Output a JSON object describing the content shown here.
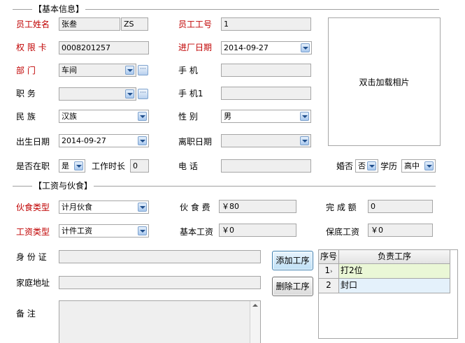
{
  "sections": {
    "basic": "【基本信息】",
    "wage": "【工资与伙食】"
  },
  "basic": {
    "name_label": "员工姓名",
    "name_value": "张叁",
    "name_code": "ZS",
    "empno_label": "员工工号",
    "empno_value": "1",
    "card_label": "权 限 卡",
    "card_value": "0008201257",
    "joindate_label": "进厂日期",
    "joindate_value": "2014-09-27",
    "dept_label": "部    门",
    "dept_value": "车间",
    "mobile_label": "手    机",
    "mobile_value": "",
    "position_label": "职    务",
    "position_value": "",
    "mobile1_label": "手    机1",
    "mobile1_value": "",
    "ethnic_label": "民    族",
    "ethnic_value": "汉族",
    "gender_label": "性    别",
    "gender_value": "男",
    "birth_label": "出生日期",
    "birth_value": "2014-09-27",
    "leave_label": "离职日期",
    "leave_value": "",
    "onjob_label": "是否在职",
    "onjob_value": "是",
    "worktime_label": "工作时长",
    "worktime_value": "0",
    "phone_label": "电    话",
    "phone_value": "",
    "marital_label": "婚否",
    "marital_value": "否",
    "edu_label": "学历",
    "edu_value": "高中",
    "photo_text": "双击加载相片"
  },
  "wage": {
    "meal_type_label": "伙食类型",
    "meal_type_value": "计月伙食",
    "meal_fee_label": "伙 食 费",
    "meal_fee_value": "￥80",
    "done_label": "完 成 额",
    "done_value": "0",
    "wage_type_label": "工资类型",
    "wage_type_value": "计件工资",
    "base_label": "基本工资",
    "base_value": "￥0",
    "min_label": "保底工资",
    "min_value": "￥0"
  },
  "extra": {
    "id_label": "身 份 证",
    "id_value": "",
    "address_label": "家庭地址",
    "address_value": "",
    "remark_label": "备    注",
    "remark_value": ""
  },
  "process": {
    "add_label": "添加工序",
    "delete_label": "删除工序",
    "col_seq": "序号",
    "col_name": "负责工序",
    "rows": [
      {
        "seq": "1",
        "name": "打2位"
      },
      {
        "seq": "2",
        "name": "封口"
      }
    ]
  },
  "colors": {
    "required_label": "#c00000",
    "selected_row": "#eaf7d6",
    "alt_row": "#e4f1fb"
  }
}
